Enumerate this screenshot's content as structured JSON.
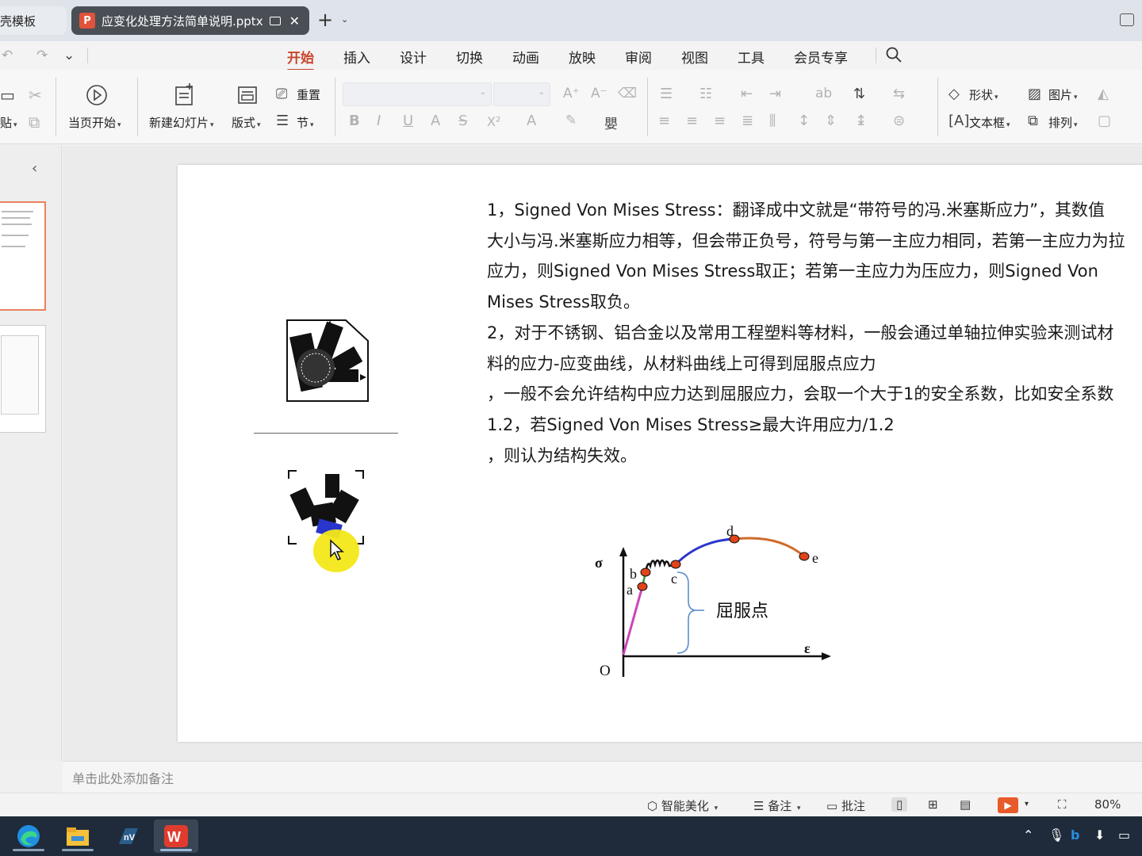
{
  "tabs": {
    "first_label": "壳模板",
    "doc_label": "应变化处理方法简单说明.pptx",
    "close": "✕",
    "new_tab": "+",
    "new_tab_dropdown": "⌄"
  },
  "quick_access": {
    "undo": "↶",
    "redo": "↷",
    "more": "⌄"
  },
  "menu": {
    "items": [
      "开始",
      "插入",
      "设计",
      "切换",
      "动画",
      "放映",
      "审阅",
      "视图",
      "工具",
      "会员专享"
    ],
    "active_index": 0
  },
  "ribbon": {
    "paste": "贴",
    "from_current": "当页开始",
    "new_slide": "新建幻灯片",
    "layout": "版式",
    "reset": "重置",
    "section": "节",
    "font_name": "",
    "font_size": "",
    "superscript": "X²",
    "shape": "形状",
    "picture": "图片",
    "textbox": "文本框",
    "arrange": "排列"
  },
  "slide": {
    "paragraphs": [
      "1，Signed Von Mises Stress：翻译成中文就是“带符号的冯.米塞斯应力”，其数值",
      "大小与冯.米塞斯应力相等，但会带正负号，符号与第一主应力相同，若第一主应力为拉",
      "应力，则Signed Von Mises Stress取正；若第一主应力为压应力，则Signed Von",
      "Mises Stress取负。",
      "2，对于不锈钢、铝合金以及常用工程塑料等材料，一般会通过单轴拉伸实验来测试材",
      "料的应力-应变曲线，从材料曲线上可得到屈服点应力",
      "，一般不会允许结构中应力达到屈服应力，会取一个大于1的安全系数，比如安全系数",
      "1.2，若Signed Von Mises Stress≥最大许用应力/1.2",
      "，则认为结构失效。"
    ]
  },
  "diagram": {
    "sigma": "σ",
    "epsilon": "ε",
    "origin": "O",
    "point_a": "a",
    "point_b": "b",
    "point_c": "c",
    "point_d": "d",
    "point_e": "e",
    "yield_label": "屈服点"
  },
  "notes": {
    "placeholder": "单击此处添加备注"
  },
  "status": {
    "beautify": "智能美化",
    "notes": "备注",
    "comment": "批注",
    "zoom": "80%"
  },
  "colors": {
    "accent": "#c8452c",
    "elastic": "#cc44bb",
    "hardening": "#2a35cc",
    "necking": "#d06a2a",
    "point": "#e04418",
    "bracket": "#5b8fc8",
    "highlight": "#f3e818",
    "taskbar": "#1f2b3a"
  }
}
